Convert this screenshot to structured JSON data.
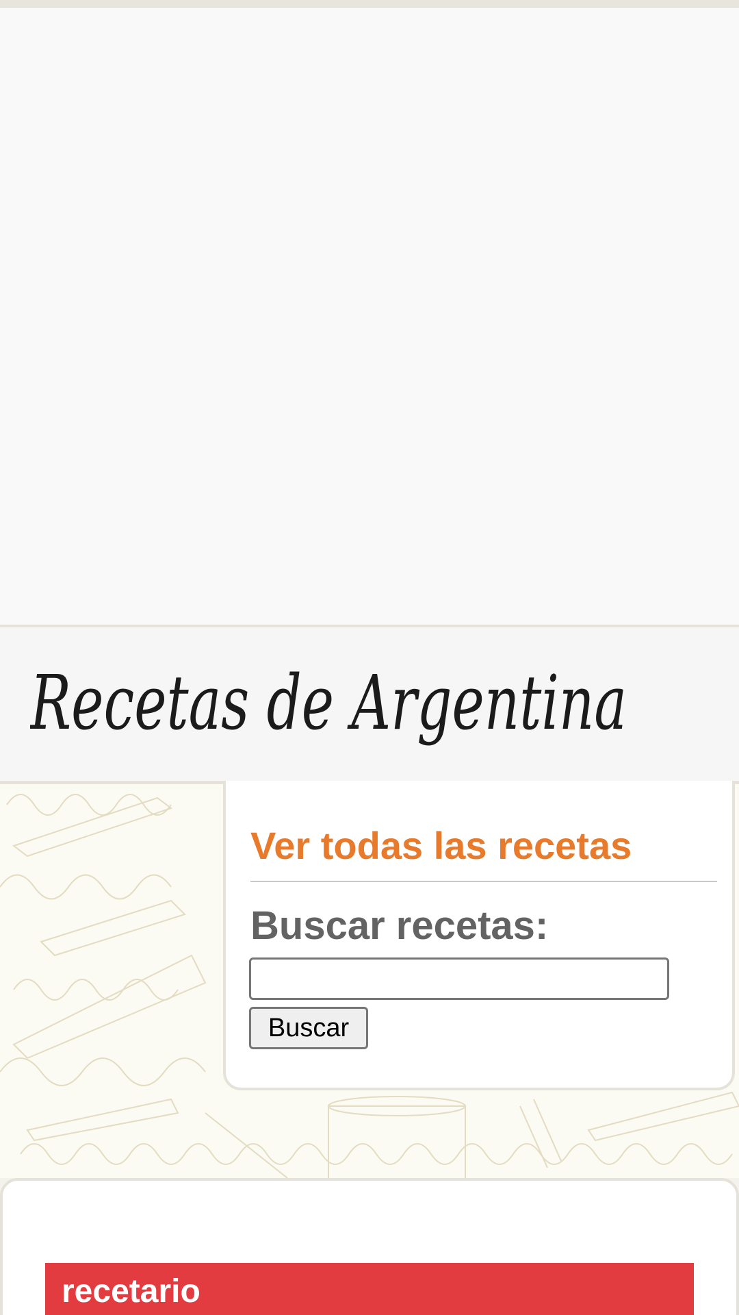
{
  "site": {
    "logo_text": "Recetas de Argentina"
  },
  "search_panel": {
    "all_recipes_link": "Ver todas las recetas",
    "search_label": "Buscar recetas:",
    "search_input_value": "",
    "search_button_label": "Buscar"
  },
  "content": {
    "section_title": "recetario"
  },
  "colors": {
    "link_orange": "#e87a2c",
    "section_red": "#e23c40",
    "label_gray": "#636363"
  }
}
